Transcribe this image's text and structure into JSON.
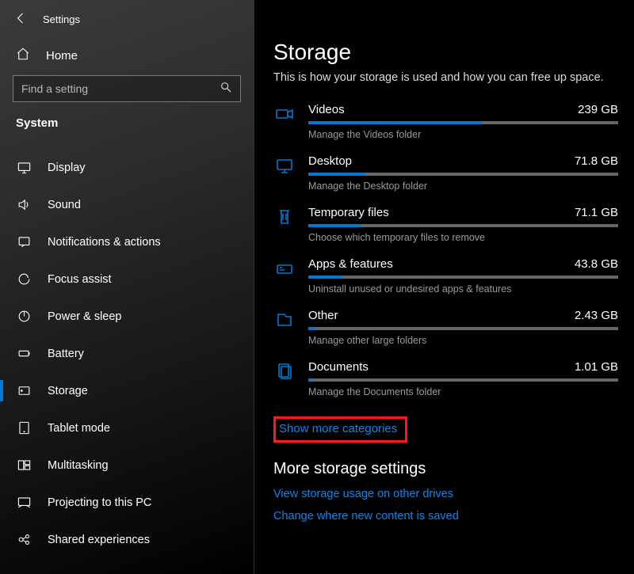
{
  "header": {
    "title": "Settings"
  },
  "home_label": "Home",
  "search": {
    "placeholder": "Find a setting"
  },
  "section": "System",
  "nav": [
    {
      "id": "display",
      "label": "Display"
    },
    {
      "id": "sound",
      "label": "Sound"
    },
    {
      "id": "notifications",
      "label": "Notifications & actions"
    },
    {
      "id": "focus-assist",
      "label": "Focus assist"
    },
    {
      "id": "power-sleep",
      "label": "Power & sleep"
    },
    {
      "id": "battery",
      "label": "Battery"
    },
    {
      "id": "storage",
      "label": "Storage",
      "selected": true
    },
    {
      "id": "tablet-mode",
      "label": "Tablet mode"
    },
    {
      "id": "multitasking",
      "label": "Multitasking"
    },
    {
      "id": "projecting",
      "label": "Projecting to this PC"
    },
    {
      "id": "shared-experiences",
      "label": "Shared experiences"
    }
  ],
  "page": {
    "title": "Storage",
    "subtitle": "This is how your storage is used and how you can free up space.",
    "items": [
      {
        "id": "videos",
        "label": "Videos",
        "size": "239 GB",
        "desc": "Manage the Videos folder",
        "fill": 56
      },
      {
        "id": "desktop",
        "label": "Desktop",
        "size": "71.8 GB",
        "desc": "Manage the Desktop folder",
        "fill": 18
      },
      {
        "id": "temp",
        "label": "Temporary files",
        "size": "71.1 GB",
        "desc": "Choose which temporary files to remove",
        "fill": 17
      },
      {
        "id": "apps",
        "label": "Apps & features",
        "size": "43.8 GB",
        "desc": "Uninstall unused or undesired apps & features",
        "fill": 11
      },
      {
        "id": "other",
        "label": "Other",
        "size": "2.43 GB",
        "desc": "Manage other large folders",
        "fill": 2
      },
      {
        "id": "documents",
        "label": "Documents",
        "size": "1.01 GB",
        "desc": "Manage the Documents folder",
        "fill": 1
      }
    ],
    "show_more": "Show more categories",
    "more_heading": "More storage settings",
    "links": [
      "View storage usage on other drives",
      "Change where new content is saved"
    ]
  }
}
